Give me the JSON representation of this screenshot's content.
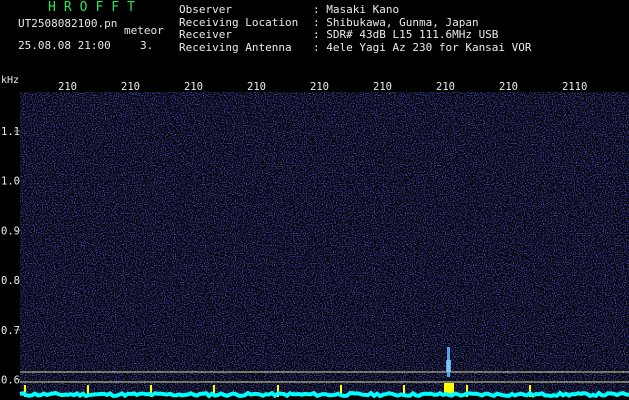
{
  "header": {
    "app_title": "HROFFT",
    "file_name": "UT2508082100.pn",
    "mode": "meteor",
    "timestamp": "25.08.08 21:00",
    "count": "3."
  },
  "station_info": [
    {
      "label": "Observer",
      "value": ": Masaki Kano"
    },
    {
      "label": "Receiving Location",
      "value": ": Shibukawa, Gunma, Japan"
    },
    {
      "label": "Receiver",
      "value": ": SDR# 43dB L15 111.6MHz USB"
    },
    {
      "label": "Receiving Antenna",
      "value": ": 4ele Yagi Az 230 for Kansai VOR"
    }
  ],
  "spectrogram": {
    "unit_label": "kHz",
    "x_tick_labels": [
      "210",
      "210",
      "210",
      "210",
      "210",
      "210",
      "210",
      "210",
      "2110"
    ],
    "y_tick_labels": [
      "1.1",
      "1.0",
      "0.9",
      "0.8",
      "0.7",
      "0.6"
    ],
    "colors": {
      "background": "#000000",
      "noise_dark": "#1a1a9a",
      "noise_bright": "#3c46ff",
      "baseline": "#00ffff",
      "marker": "#ffff00",
      "reference_line": "#d8d8a0"
    },
    "minute_marker_count": 9
  }
}
